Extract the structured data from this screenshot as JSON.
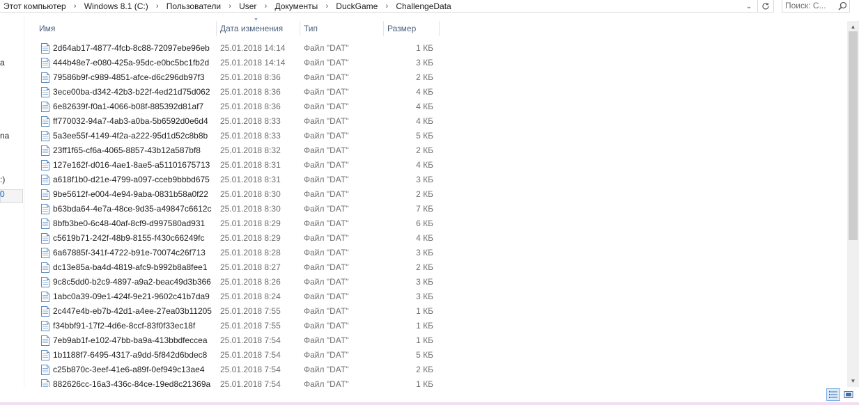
{
  "address_bar": {
    "crumbs": [
      "Этот компьютер",
      "Windows 8.1 (C:)",
      "Пользователи",
      "User",
      "Документы",
      "DuckGame",
      "ChallengeData"
    ],
    "dropdown_icon": "chevron-down-icon",
    "refresh_icon": "refresh-icon"
  },
  "search": {
    "placeholder": "Поиск: C...",
    "icon": "search-icon"
  },
  "nav_pane": {
    "fragments": [
      "a",
      "na",
      ":)",
      "0"
    ]
  },
  "columns": {
    "name": "Имя",
    "date": "Дата изменения",
    "type": "Тип",
    "size": "Размер",
    "sorted_by": "date"
  },
  "files": [
    {
      "name": "2d64ab17-4877-4fcb-8c88-72097ebe96eb",
      "date": "25.01.2018 14:14",
      "type": "Файл \"DAT\"",
      "size": "1 КБ"
    },
    {
      "name": "444b48e7-e080-425a-95dc-e0bc5bc1fb2d",
      "date": "25.01.2018 14:14",
      "type": "Файл \"DAT\"",
      "size": "3 КБ"
    },
    {
      "name": "79586b9f-c989-4851-afce-d6c296db97f3",
      "date": "25.01.2018 8:36",
      "type": "Файл \"DAT\"",
      "size": "2 КБ"
    },
    {
      "name": "3ece00ba-d342-42b3-b22f-4ed21d75d062",
      "date": "25.01.2018 8:36",
      "type": "Файл \"DAT\"",
      "size": "4 КБ"
    },
    {
      "name": "6e82639f-f0a1-4066-b08f-885392d81af7",
      "date": "25.01.2018 8:36",
      "type": "Файл \"DAT\"",
      "size": "4 КБ"
    },
    {
      "name": "ff770032-94a7-4ab3-a0ba-5b6592d0e6d4",
      "date": "25.01.2018 8:33",
      "type": "Файл \"DAT\"",
      "size": "4 КБ"
    },
    {
      "name": "5a3ee55f-4149-4f2a-a222-95d1d52c8b8b",
      "date": "25.01.2018 8:33",
      "type": "Файл \"DAT\"",
      "size": "5 КБ"
    },
    {
      "name": "23ff1f65-cf6a-4065-8857-43b12a587bf8",
      "date": "25.01.2018 8:32",
      "type": "Файл \"DAT\"",
      "size": "2 КБ"
    },
    {
      "name": "127e162f-d016-4ae1-8ae5-a51101675713",
      "date": "25.01.2018 8:31",
      "type": "Файл \"DAT\"",
      "size": "4 КБ"
    },
    {
      "name": "a618f1b0-d21e-4799-a097-cceb9bbbd675",
      "date": "25.01.2018 8:31",
      "type": "Файл \"DAT\"",
      "size": "3 КБ"
    },
    {
      "name": "9be5612f-e004-4e94-9aba-0831b58a0f22",
      "date": "25.01.2018 8:30",
      "type": "Файл \"DAT\"",
      "size": "2 КБ"
    },
    {
      "name": "b63bda64-4e7a-48ce-9d35-a49847c6612c",
      "date": "25.01.2018 8:30",
      "type": "Файл \"DAT\"",
      "size": "7 КБ"
    },
    {
      "name": "8bfb3be0-6c48-40af-8cf9-d997580ad931",
      "date": "25.01.2018 8:29",
      "type": "Файл \"DAT\"",
      "size": "6 КБ"
    },
    {
      "name": "c5619b71-242f-48b9-8155-f430c66249fc",
      "date": "25.01.2018 8:29",
      "type": "Файл \"DAT\"",
      "size": "4 КБ"
    },
    {
      "name": "6a67885f-341f-4722-b91e-70074c26f713",
      "date": "25.01.2018 8:28",
      "type": "Файл \"DAT\"",
      "size": "3 КБ"
    },
    {
      "name": "dc13e85a-ba4d-4819-afc9-b992b8a8fee1",
      "date": "25.01.2018 8:27",
      "type": "Файл \"DAT\"",
      "size": "2 КБ"
    },
    {
      "name": "9c8c5dd0-b2c9-4897-a9a2-beac49d3b366",
      "date": "25.01.2018 8:26",
      "type": "Файл \"DAT\"",
      "size": "3 КБ"
    },
    {
      "name": "1abc0a39-09e1-424f-9e21-9602c41b7da9",
      "date": "25.01.2018 8:24",
      "type": "Файл \"DAT\"",
      "size": "3 КБ"
    },
    {
      "name": "2c447e4b-eb7b-42d1-a4ee-27ea03b11205",
      "date": "25.01.2018 7:55",
      "type": "Файл \"DAT\"",
      "size": "1 КБ"
    },
    {
      "name": "f34bbf91-17f2-4d6e-8ccf-83f0f33ec18f",
      "date": "25.01.2018 7:55",
      "type": "Файл \"DAT\"",
      "size": "1 КБ"
    },
    {
      "name": "7eb9ab1f-e102-47bb-ba9a-413bbdfeccea",
      "date": "25.01.2018 7:54",
      "type": "Файл \"DAT\"",
      "size": "1 КБ"
    },
    {
      "name": "1b1188f7-6495-4317-a9dd-5f842d6bdec8",
      "date": "25.01.2018 7:54",
      "type": "Файл \"DAT\"",
      "size": "5 КБ"
    },
    {
      "name": "c25b870c-3eef-41e6-a89f-0ef949c13ae4",
      "date": "25.01.2018 7:54",
      "type": "Файл \"DAT\"",
      "size": "2 КБ"
    },
    {
      "name": "882626cc-16a3-436c-84ce-19ed8c21369a",
      "date": "25.01.2018 7:54",
      "type": "Файл \"DAT\"",
      "size": "1 КБ"
    }
  ],
  "file_icon": "dat-file-icon",
  "view_buttons": [
    {
      "icon": "details-view-icon",
      "active": true
    },
    {
      "icon": "large-icons-view-icon",
      "active": false
    }
  ],
  "colors": {
    "header_text": "#4c607a",
    "accent_blue": "#0066cc",
    "selected_view": "#dbe9f8",
    "bottom_edge": "#f1dff1"
  }
}
